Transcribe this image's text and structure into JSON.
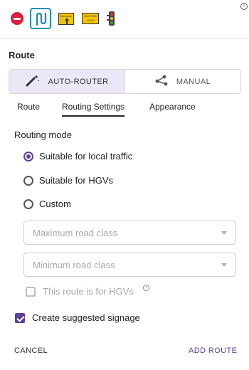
{
  "toolbar": {
    "icons": [
      "no-entry-icon",
      "route-icon",
      "diversion-sign-icon",
      "custom-sign-icon",
      "traffic-light-icon"
    ],
    "sign1_text": "Diversion",
    "sign2_text": "CUSTOM SIGN"
  },
  "section_title": "Route",
  "mode_toggle": {
    "auto_label": "AUTO-ROUTER",
    "manual_label": "MANUAL",
    "selected": "AUTO-ROUTER"
  },
  "tabs": [
    {
      "label": "Route"
    },
    {
      "label": "Routing Settings",
      "active": true
    },
    {
      "label": "Appearance"
    }
  ],
  "routing_mode": {
    "label": "Routing mode",
    "options": [
      {
        "label": "Suitable for local traffic",
        "checked": true
      },
      {
        "label": "Suitable for HGVs",
        "checked": false
      },
      {
        "label": "Custom",
        "checked": false
      }
    ]
  },
  "selects": {
    "max_placeholder": "Maximum road class",
    "min_placeholder": "Minimum road class"
  },
  "hgv_checkbox": {
    "label": "This route is for HGVs",
    "checked": false,
    "disabled": true
  },
  "signage_checkbox": {
    "label": "Create suggested signage",
    "checked": true
  },
  "footer": {
    "cancel": "CANCEL",
    "add": "ADD ROUTE"
  },
  "colors": {
    "accent": "#5b3e9c",
    "toggle_active_bg": "#ece7f7",
    "route_icon": "#1f8fb5",
    "no_entry": "#d9213a"
  }
}
